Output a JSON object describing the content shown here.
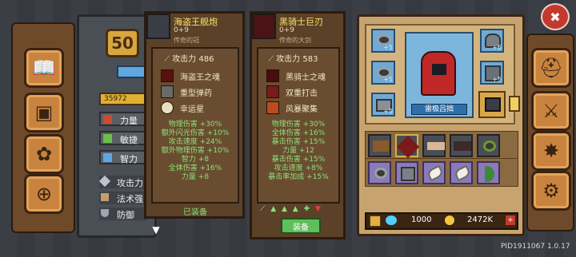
{
  "level": "50",
  "xp_text": "35972",
  "char_stats": [
    {
      "label": "力量",
      "icon": "strength-icon"
    },
    {
      "label": "敏捷",
      "icon": "agility-icon"
    },
    {
      "label": "智力",
      "icon": "intellect-icon"
    },
    {
      "label": "攻击力",
      "icon": "sword-icon"
    },
    {
      "label": "法术强",
      "icon": "staff-icon"
    },
    {
      "label": "防御",
      "icon": "shield-icon"
    }
  ],
  "tooltip_left": {
    "name": "海盗王舰炮",
    "level": "0+9",
    "rarity": "传奇的冠",
    "attack_label": "攻击力 486",
    "skills": [
      "海盗王之魂",
      "重型弹药",
      "幸运星"
    ],
    "bonuses": [
      "物理伤害 +30%",
      "额外闪光伤害 +10%",
      "攻击速度 +24%",
      "额外物理伤害 +10%",
      "智力 +8",
      "全体伤害 +16%",
      "力量 +8"
    ],
    "status": "已装备"
  },
  "tooltip_right": {
    "name": "黑骑士巨刃",
    "level": "0+9",
    "rarity": "传奇的大剑",
    "attack_label": "攻击力 583",
    "skills": [
      "黑骑士之魂",
      "双重打击",
      "风暴聚集"
    ],
    "bonuses": [
      "物理伤害 +30%",
      "全体伤害 +16%",
      "暴击伤害 +15%",
      "力量 +12",
      "暴击伤害 +15%",
      "攻击速度 +8%",
      "暴击率加成 +15%"
    ],
    "equip_label": "装备"
  },
  "character_name": "雷极吕拙",
  "equip_plus": [
    "+5",
    "+5",
    "+9",
    "+6",
    "+5"
  ],
  "currency": {
    "gems": "1000",
    "gold": "2472K"
  },
  "pid": "PID1911067 1.0.17",
  "colors": {
    "gold": "#ffe36a",
    "green_stat": "#8fe07a",
    "wood": "#6e4a2a"
  }
}
